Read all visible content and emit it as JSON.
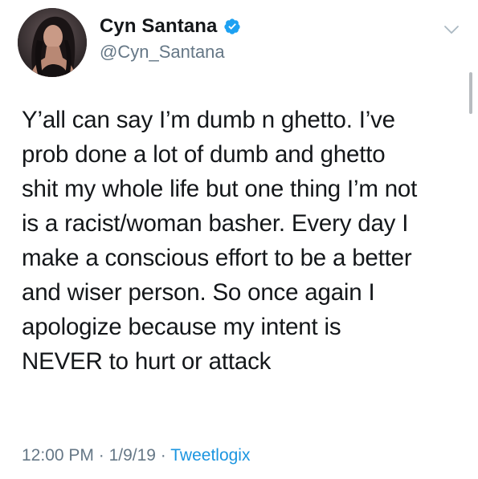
{
  "user": {
    "display_name": "Cyn Santana",
    "handle": "@Cyn_Santana",
    "verified": true,
    "verified_color": "#1da1f2"
  },
  "tweet": {
    "lines": [
      "Y’all can say I’m dumb n ghetto. I’ve",
      "prob done a lot of dumb and ghetto",
      "shit my whole life but one thing I’m not",
      "is a racist/woman basher. Every day I",
      "make a conscious effort to be a better",
      "and wiser person. So once again I",
      "apologize because my intent is",
      "NEVER to hurt or attack"
    ]
  },
  "meta": {
    "time": "12:00 PM",
    "sep1": " · ",
    "date": "1/9/19",
    "sep2": " · ",
    "source": "Tweetlogix",
    "source_color": "#1b95e0"
  },
  "icons": {
    "verified": "verified-badge-icon",
    "menu": "chevron-down-icon"
  }
}
